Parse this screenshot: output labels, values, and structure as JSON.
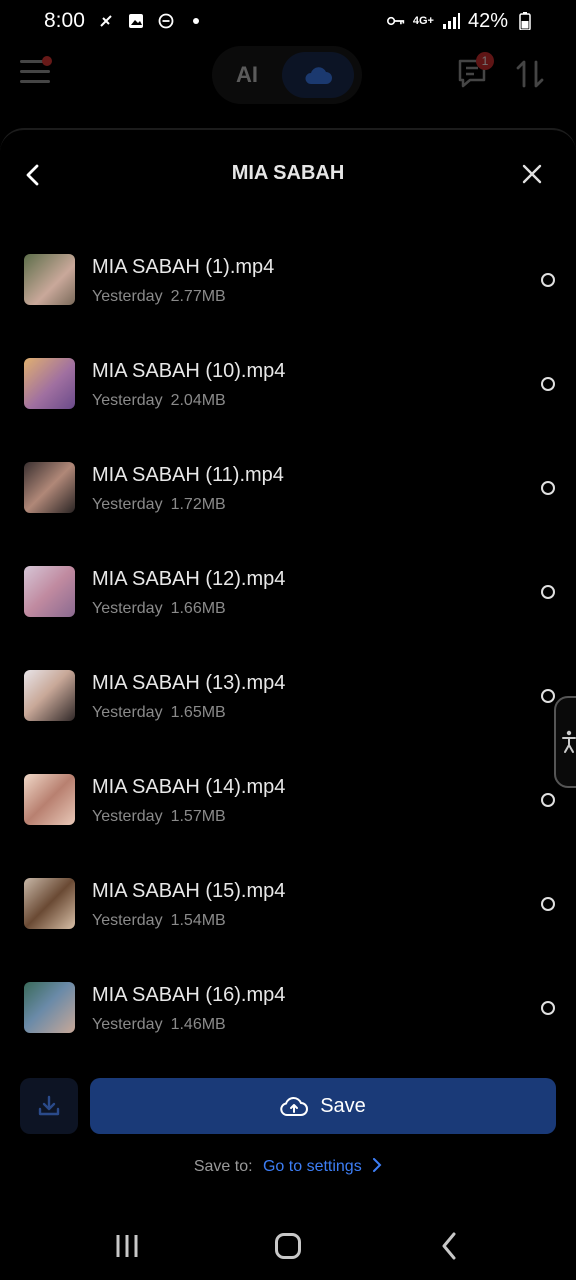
{
  "status_bar": {
    "time": "8:00",
    "network": "4G+",
    "battery": "42%"
  },
  "app_header": {
    "mode_ai_label": "AI",
    "chat_badge_count": "1"
  },
  "sheet": {
    "title": "MIA SABAH"
  },
  "files": [
    {
      "name": "MIA SABAH (1).mp4",
      "date": "Yesterday",
      "size": "2.77MB",
      "thumb_color": "#6b7a58"
    },
    {
      "name": "MIA SABAH (10).mp4",
      "date": "Yesterday",
      "size": "2.04MB",
      "thumb_color": "#a07a6a"
    },
    {
      "name": "MIA SABAH (11).mp4",
      "date": "Yesterday",
      "size": "1.72MB",
      "thumb_color": "#4a3e38"
    },
    {
      "name": "MIA SABAH (12).mp4",
      "date": "Yesterday",
      "size": "1.66MB",
      "thumb_color": "#b58a9a"
    },
    {
      "name": "MIA SABAH (13).mp4",
      "date": "Yesterday",
      "size": "1.65MB",
      "thumb_color": "#cfc4c8"
    },
    {
      "name": "MIA SABAH (14).mp4",
      "date": "Yesterday",
      "size": "1.57MB",
      "thumb_color": "#c29a88"
    },
    {
      "name": "MIA SABAH (15).mp4",
      "date": "Yesterday",
      "size": "1.54MB",
      "thumb_color": "#7a5a44"
    },
    {
      "name": "MIA SABAH (16).mp4",
      "date": "Yesterday",
      "size": "1.46MB",
      "thumb_color": "#4e6a5a"
    }
  ],
  "actions": {
    "save_label": "Save",
    "save_to_label": "Save to:",
    "settings_link": "Go to settings"
  },
  "colors": {
    "accent": "#3d7ef5",
    "save_button": "#1a3a78",
    "badge": "#d32f2f"
  }
}
